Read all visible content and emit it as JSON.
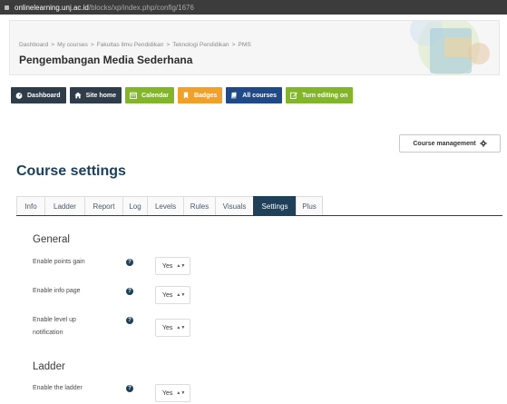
{
  "browser": {
    "url_host": "onlinelearning.unj.ac.id",
    "url_path": "/blocks/xp/index.php/config/1676"
  },
  "header": {
    "breadcrumb": [
      "Dashboard",
      "My courses",
      "Fakultas Ilmu Pendidikan",
      "Teknologi Pendidikan",
      "PMS"
    ],
    "course_title": "Pengembangan Media Sederhana"
  },
  "nav": {
    "dashboard": "Dashboard",
    "site_home": "Site home",
    "calendar": "Calendar",
    "badges": "Badges",
    "all_courses": "All courses",
    "turn_editing_on": "Turn editing on"
  },
  "course_management": {
    "label": "Course management"
  },
  "page": {
    "title": "Course settings"
  },
  "tabs": [
    "Info",
    "Ladder",
    "Report",
    "Log",
    "Levels",
    "Rules",
    "Visuals",
    "Settings",
    "Plus"
  ],
  "active_tab": "Settings",
  "form": {
    "general": {
      "title": "General",
      "enable_points_gain": {
        "label": "Enable points gain",
        "value": "Yes"
      },
      "enable_info_page": {
        "label": "Enable info page",
        "value": "Yes"
      },
      "enable_level_up_notification": {
        "label": "Enable level up notification",
        "value": "Yes"
      }
    },
    "ladder": {
      "title": "Ladder",
      "enable_the_ladder": {
        "label": "Enable the ladder",
        "value": "Yes"
      }
    }
  },
  "colors": {
    "primary": "#1f4058",
    "button_dark": "#2f3d4a",
    "button_green": "#83b52a",
    "button_orange": "#f0a12a",
    "button_blue": "#1f4a87"
  }
}
